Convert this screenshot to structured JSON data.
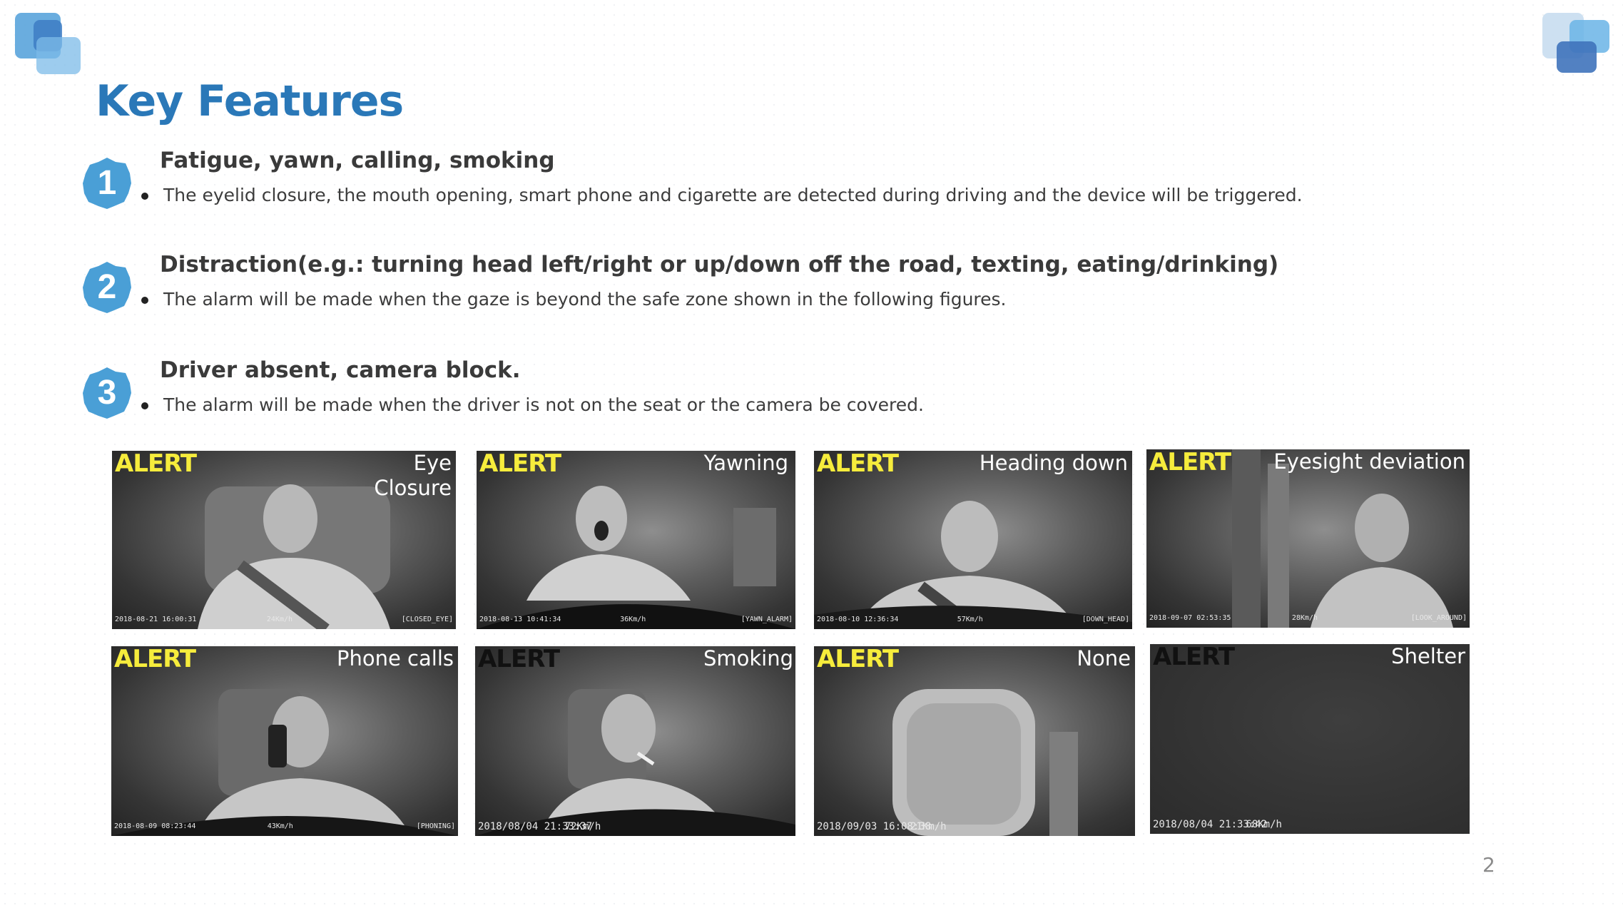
{
  "title": "Key Features",
  "features": [
    {
      "number": "1",
      "heading": "Fatigue, yawn, calling, smoking",
      "bullet": "The eyelid closure, the mouth opening, smart phone and cigarette are detected during driving and the device will be triggered."
    },
    {
      "number": "2",
      "heading": "Distraction(e.g.: turning head left/right or up/down off the road, texting, eating/drinking)",
      "bullet": "The alarm will be made when the gaze is beyond the safe zone shown in the following figures."
    },
    {
      "number": "3",
      "heading": "Driver absent, camera block.",
      "bullet": "The alarm will be made when the driver is not on the seat or the camera be covered."
    }
  ],
  "images": [
    {
      "alert": "ALERT",
      "label": "Eye Closure",
      "date": "2018-08-21 16:00:31",
      "speed": "24Km/h",
      "code": "[CLOSED_EYE]"
    },
    {
      "alert": "ALERT",
      "label": "Yawning",
      "date": "2018-08-13 10:41:34",
      "speed": "36Km/h",
      "code": "[YAWN_ALARM]"
    },
    {
      "alert": "ALERT",
      "label": "Heading down",
      "date": "2018-08-10 12:36:34",
      "speed": "57Km/h",
      "code": "[DOWN_HEAD]"
    },
    {
      "alert": "ALERT",
      "label": "Eyesight deviation",
      "date": "2018-09-07 02:53:35",
      "speed": "28Km/h",
      "code": "[LOOK_AROUND]"
    },
    {
      "alert": "ALERT",
      "label": "Phone calls",
      "date": "2018-08-09 08:23:44",
      "speed": "43Km/h",
      "code": "[PHONING]"
    },
    {
      "alert": "ALERT",
      "label": "Smoking",
      "date": "2018/08/04 21:33:37",
      "speed": "72Km/h",
      "code": ""
    },
    {
      "alert": "ALERT",
      "label": "None",
      "date": "2018/09/03 16:08:38",
      "speed": "21Km/h",
      "code": ""
    },
    {
      "alert": "ALERT",
      "label": "Shelter",
      "date": "2018/08/04 21:33:42",
      "speed": "68Km/h",
      "code": ""
    }
  ],
  "page_number": "2",
  "colors": {
    "title": "#2a78b8",
    "badge": "#4a9fd6",
    "alert": "#f6ec3c"
  }
}
